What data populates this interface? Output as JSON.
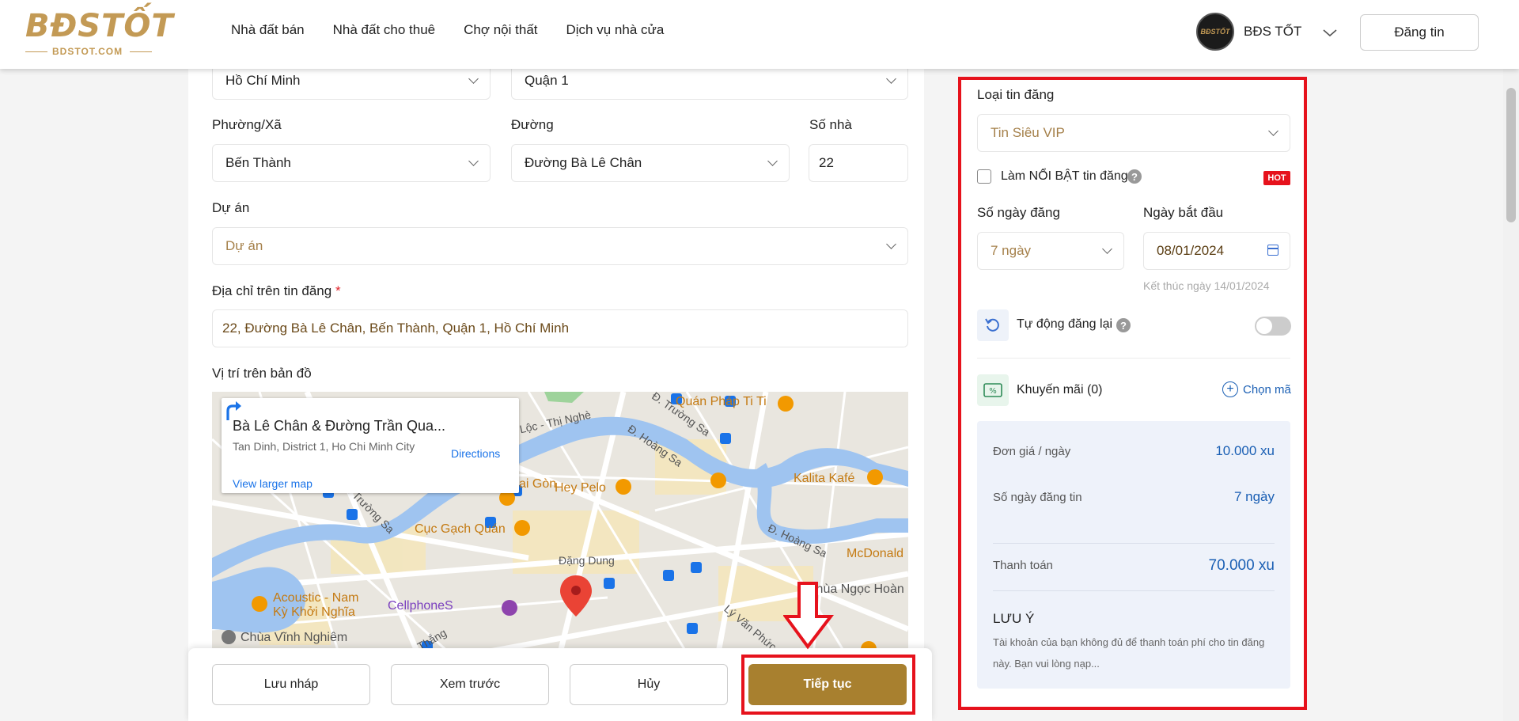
{
  "header": {
    "logo_main": "BĐSTỐT",
    "logo_sub": "BDSTOT.COM",
    "nav": [
      "Nhà đất bán",
      "Nhà đất cho thuê",
      "Chợ nội thất",
      "Dịch vụ nhà cửa"
    ],
    "avatar_text": "BĐSTỐT",
    "user_name": "BĐS TỐT",
    "post_button": "Đăng tin"
  },
  "form": {
    "province": "Hồ Chí Minh",
    "district": "Quận 1",
    "ward_label": "Phường/Xã",
    "ward": "Bến Thành",
    "street_label": "Đường",
    "street": "Đường Bà Lê Chân",
    "house_no_label": "Số nhà",
    "house_no": "22",
    "project_label": "Dự án",
    "project_placeholder": "Dự án",
    "address_label": "Địa chỉ trên tin đăng",
    "address_required": "*",
    "address": "22, Đường Bà Lê Chân, Bến Thành, Quận 1, Hồ Chí Minh",
    "map_label": "Vị trí trên bản đồ"
  },
  "map": {
    "card_title": "Bà Lê Chân & Đường Trần Qua...",
    "card_sub": "Tan Dinh, District 1, Ho Chi Minh City",
    "directions": "Directions",
    "larger_map": "View larger map",
    "places": [
      {
        "name": "Quán Pháp Ti Ti",
        "kind": "food"
      },
      {
        "name": "Hey Pelo",
        "kind": "food"
      },
      {
        "name": "Kalita Kafé",
        "kind": "food"
      },
      {
        "name": "Cục Gạch Quán",
        "kind": "food"
      },
      {
        "name": "McDonald",
        "kind": "food"
      },
      {
        "name": "Acoustic - Nam",
        "kind": "food"
      },
      {
        "name": "Kỳ Khởi Nghĩa",
        "kind": "food"
      },
      {
        "name": "CellphoneS",
        "kind": "purple"
      },
      {
        "name": "Chùa Vĩnh Nghiêm",
        "kind": "gray"
      },
      {
        "name": "Chùa Ngọc Hoàn",
        "kind": "gray"
      },
      {
        "name": "ai Gòn",
        "kind": "food"
      }
    ],
    "streets": [
      "Đặng Dung",
      "Đ. Trường Sa",
      "Đ. Hoàng Sa",
      "Lộc - Thị Nghè",
      "Đ. Trường Sa",
      "Đ. Hoàng Sa",
      "Lý Văn Phức",
      "Thắng"
    ]
  },
  "actions": {
    "save_draft": "Lưu nháp",
    "preview": "Xem trước",
    "cancel": "Hủy",
    "continue": "Tiếp tục"
  },
  "panel": {
    "listing_type_label": "Loại tin đăng",
    "listing_type": "Tin Siêu VIP",
    "highlight_label": "Làm NỔI BẬT tin đăng",
    "hot_badge": "HOT",
    "days_label": "Số ngày đăng",
    "days": "7 ngày",
    "start_label": "Ngày bắt đầu",
    "start_date": "08/01/2024",
    "end_note": "Kết thúc ngày 14/01/2024",
    "auto_repost_label": "Tự động đăng lại",
    "promo_label": "Khuyến mãi (0)",
    "promo_link": "Chọn mã",
    "summary": {
      "unit_price_label": "Đơn giá / ngày",
      "unit_price": "10.000 xu",
      "days_label": "Số ngày đăng tin",
      "days": "7 ngày",
      "total_label": "Thanh toán",
      "total": "70.000 xu",
      "note_title": "LƯU Ý",
      "note_text": "Tài khoản của bạn không đủ để thanh toán phí cho tin đăng này. Bạn vui lòng nạp..."
    }
  }
}
